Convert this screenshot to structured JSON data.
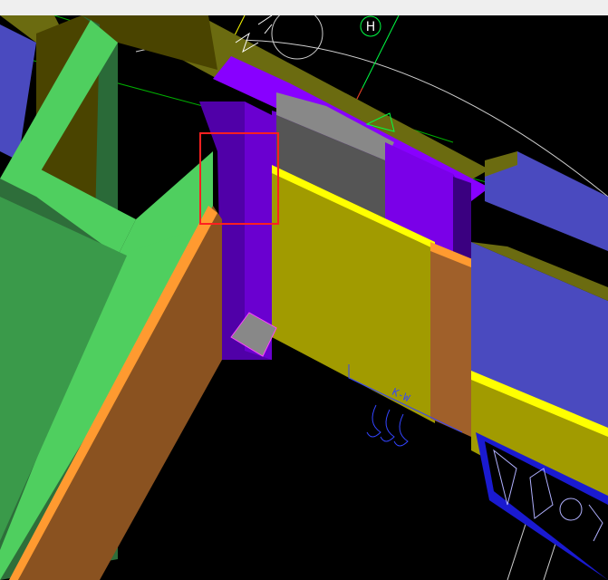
{
  "app": {
    "view_type": "3D CAD model viewport",
    "background_color": "#000000"
  },
  "grid": {
    "axis_bubble_label": "H"
  },
  "annotations": {
    "section_mark": "K-W"
  },
  "selection": {
    "highlight_color": "#ff2020"
  },
  "colors": {
    "green_member": "#4fcf5f",
    "dark_green": "#2e6e3a",
    "purple_member": "#8800ff",
    "dark_purple": "#5000a8",
    "yellow_member": "#a19b00",
    "bright_yellow": "#ffff00",
    "orange_member": "#ff9a30",
    "brown_member": "#8a5220",
    "blue_member": "#4a4abf",
    "gray_member": "#888888",
    "olive_member": "#6b6b10"
  }
}
